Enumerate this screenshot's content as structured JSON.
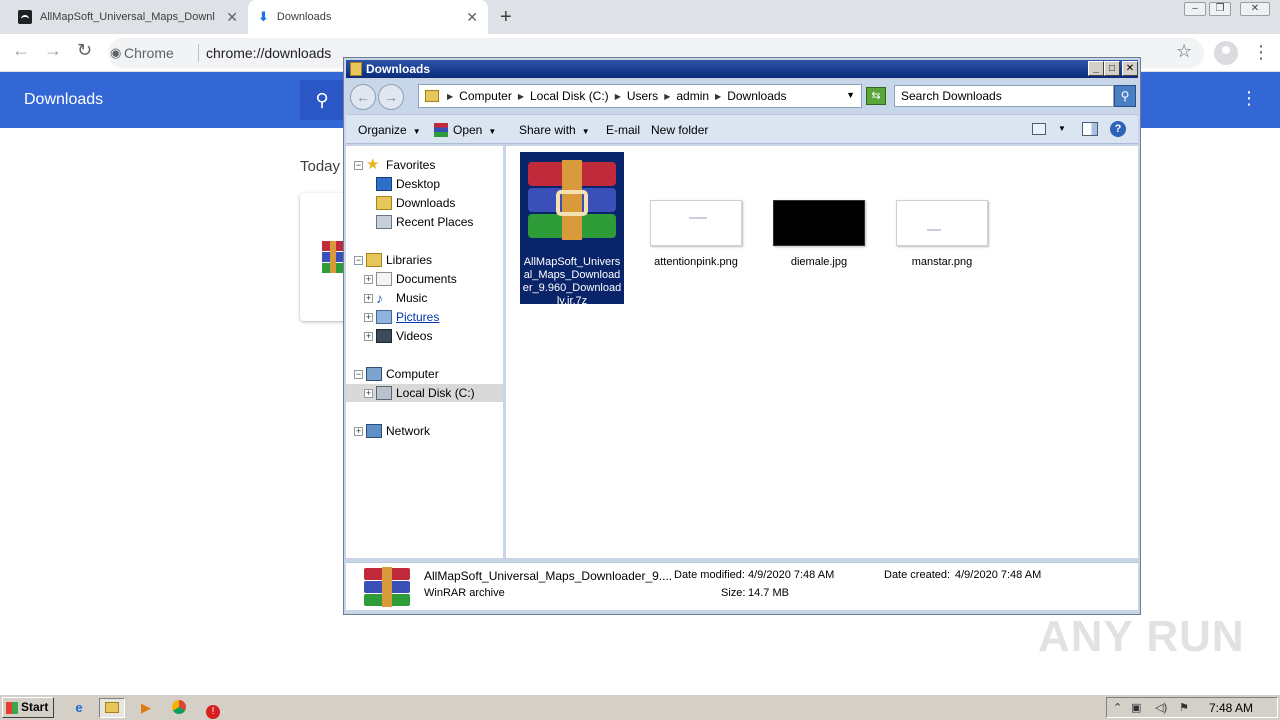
{
  "browser": {
    "tabs": [
      {
        "title": "AllMapSoft_Universal_Maps_Downlo",
        "active": false
      },
      {
        "title": "Downloads",
        "active": true
      }
    ],
    "new_tab_label": "+",
    "omnibox": {
      "site": "Chrome",
      "url": "chrome://downloads"
    },
    "page": {
      "title": "Downloads",
      "section": "Today"
    }
  },
  "explorer": {
    "title": "Downloads",
    "breadcrumbs": [
      "Computer",
      "Local Disk (C:)",
      "Users",
      "admin",
      "Downloads"
    ],
    "search_placeholder": "Search Downloads",
    "toolbar": {
      "organize": "Organize",
      "open": "Open",
      "share_with": "Share with",
      "email": "E-mail",
      "new_folder": "New folder"
    },
    "nav": {
      "favorites": "Favorites",
      "desktop": "Desktop",
      "downloads": "Downloads",
      "recent_places": "Recent Places",
      "libraries": "Libraries",
      "documents": "Documents",
      "music": "Music",
      "pictures": "Pictures",
      "videos": "Videos",
      "computer": "Computer",
      "local_disk": "Local Disk (C:)",
      "network": "Network"
    },
    "files": [
      {
        "name": "AllMapSoft_Universal_Maps_Downloader_9.960_Downloadly.ir.7z",
        "selected": true
      },
      {
        "name": "attentionpink.png"
      },
      {
        "name": "diemale.jpg"
      },
      {
        "name": "manstar.png"
      }
    ],
    "details": {
      "filename": "AllMapSoft_Universal_Maps_Downloader_9....",
      "type": "WinRAR archive",
      "date_modified_label": "Date modified:",
      "date_modified": "4/9/2020 7:48 AM",
      "date_created_label": "Date created:",
      "date_created": "4/9/2020 7:48 AM",
      "size_label": "Size:",
      "size": "14.7 MB"
    }
  },
  "taskbar": {
    "start_label": "Start",
    "clock": "7:48 AM"
  },
  "watermark": "ANY RUN"
}
